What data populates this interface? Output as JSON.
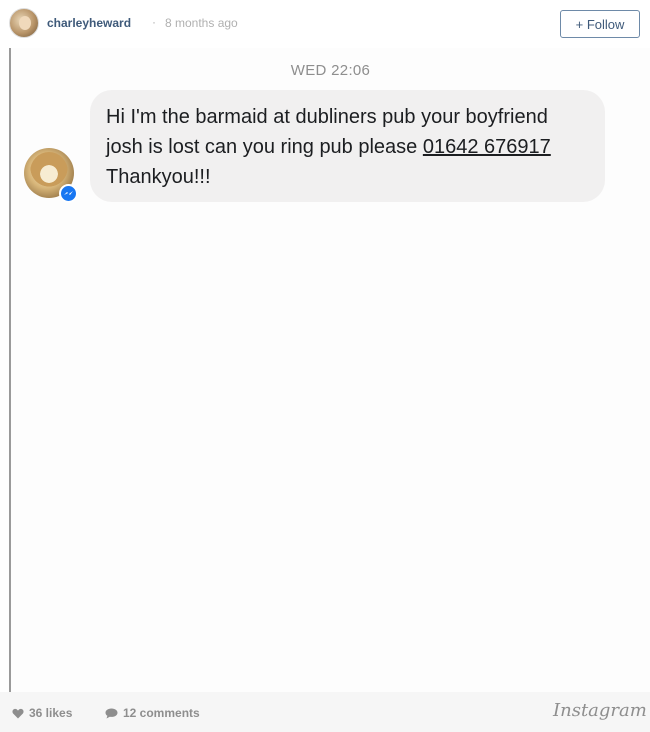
{
  "header": {
    "username": "charleyheward",
    "separator": "·",
    "time_ago": "8 months ago",
    "follow_label": "+ Follow"
  },
  "photo": {
    "timestamp": "WED 22:06",
    "message": {
      "text_before": "Hi I'm the barmaid at dubliners pub your boyfriend josh is lost can you ring pub please ",
      "phone": "01642 676917",
      "text_after": " Thankyou!!!"
    },
    "badge_color": "#1877f2"
  },
  "footer": {
    "likes": "36 likes",
    "comments": "12 comments",
    "brand": "Instagram"
  },
  "icons": {
    "like": "heart-icon",
    "comment": "speech-bubble-icon",
    "badge": "messenger-icon"
  }
}
